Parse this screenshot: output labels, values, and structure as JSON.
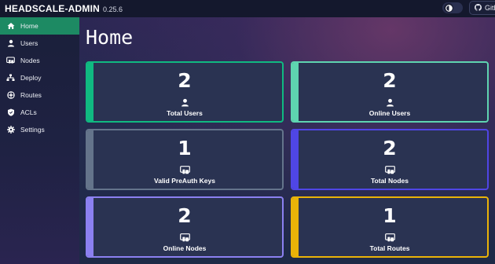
{
  "app": {
    "name": "HEADSCALE-ADMIN",
    "version": "0.25.6"
  },
  "header": {
    "theme_toggle_icon": "half-moon-icon",
    "github_label": "Github",
    "github_icon": "github-icon"
  },
  "sidebar": {
    "items": [
      {
        "label": "Home",
        "icon": "home-icon",
        "active": true
      },
      {
        "label": "Users",
        "icon": "user-icon",
        "active": false
      },
      {
        "label": "Nodes",
        "icon": "nodes-icon",
        "active": false
      },
      {
        "label": "Deploy",
        "icon": "deploy-icon",
        "active": false
      },
      {
        "label": "Routes",
        "icon": "routes-icon",
        "active": false
      },
      {
        "label": "ACLs",
        "icon": "shield-icon",
        "active": false
      },
      {
        "label": "Settings",
        "icon": "gear-icon",
        "active": false
      }
    ]
  },
  "main": {
    "title": "Home",
    "cards": [
      {
        "value": "2",
        "label": "Total Users",
        "icon": "user-icon",
        "color": "#10b981"
      },
      {
        "value": "2",
        "label": "Online Users",
        "icon": "user-icon",
        "color": "#5ed4b0"
      },
      {
        "value": "1",
        "label": "Valid PreAuth Keys",
        "icon": "devices-icon",
        "color": "#64748b"
      },
      {
        "value": "2",
        "label": "Total Nodes",
        "icon": "devices-icon",
        "color": "#4f46e5"
      },
      {
        "value": "2",
        "label": "Online Nodes",
        "icon": "devices-icon",
        "color": "#8b80f0"
      },
      {
        "value": "1",
        "label": "Total Routes",
        "icon": "routes-card-icon",
        "color": "#eab308"
      }
    ]
  },
  "colors": {
    "active_nav": "#1d8a63",
    "card_bg": "#2a3352"
  }
}
